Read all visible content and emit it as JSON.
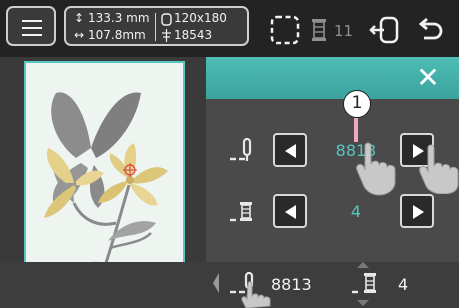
{
  "topbar": {
    "height_dim": "133.3 mm",
    "width_dim": "107.8mm",
    "frame_size": "120x180",
    "stitch_count": "18543",
    "thread_count": "11"
  },
  "panel": {
    "row1": {
      "value": "8813"
    },
    "row2": {
      "value": "4"
    },
    "callout_number": "1"
  },
  "bottom": {
    "color_code": "8813",
    "thread_number": "4"
  },
  "colors": {
    "accent": "#4fbcb6",
    "value_text": "#56c6c1",
    "callout_line": "#f2a6c6",
    "flower_yellow": "#e5d08a"
  }
}
